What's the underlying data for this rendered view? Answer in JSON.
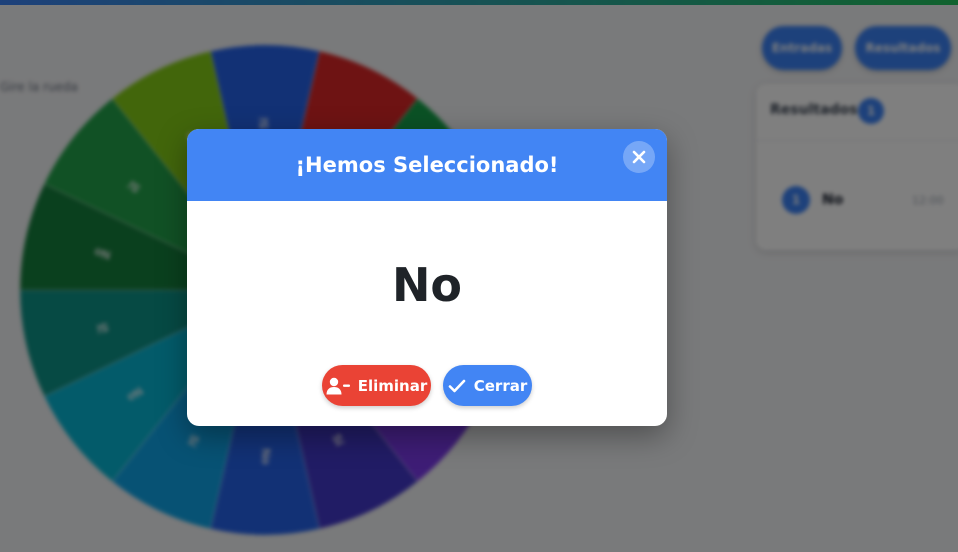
{
  "background": {
    "wheel_caption": "Gire la rueda",
    "wheel_labels": [
      "Sí",
      "No",
      "Sí",
      "No",
      "Sí",
      "No",
      "Sí",
      "No",
      "Sí",
      "No",
      "Sí",
      "No"
    ],
    "wheel_colors": [
      "#2563eb",
      "#dc2626",
      "#16a34a",
      "#eab308",
      "#f97316",
      "#7c3aed",
      "#4338ca",
      "#2563eb",
      "#0ea5e9",
      "#06b6d4",
      "#0d9488",
      "#15803d",
      "#22a34a",
      "#84cc16"
    ],
    "tabs": [
      "Entradas",
      "Resultados"
    ],
    "results_panel": {
      "title": "Resultados",
      "count": "1",
      "rows": [
        {
          "index": "1",
          "name": "No",
          "time": "12:00"
        }
      ]
    }
  },
  "modal": {
    "title": "¡Hemos Seleccionado!",
    "selected": "No",
    "remove_label": "Eliminar",
    "close_label": "Cerrar",
    "close_icon": "close-icon",
    "remove_icon": "user-minus-icon",
    "confirm_icon": "check-icon"
  },
  "colors": {
    "header": "#4285f4",
    "remove": "#ea4335",
    "close": "#4285f4"
  }
}
